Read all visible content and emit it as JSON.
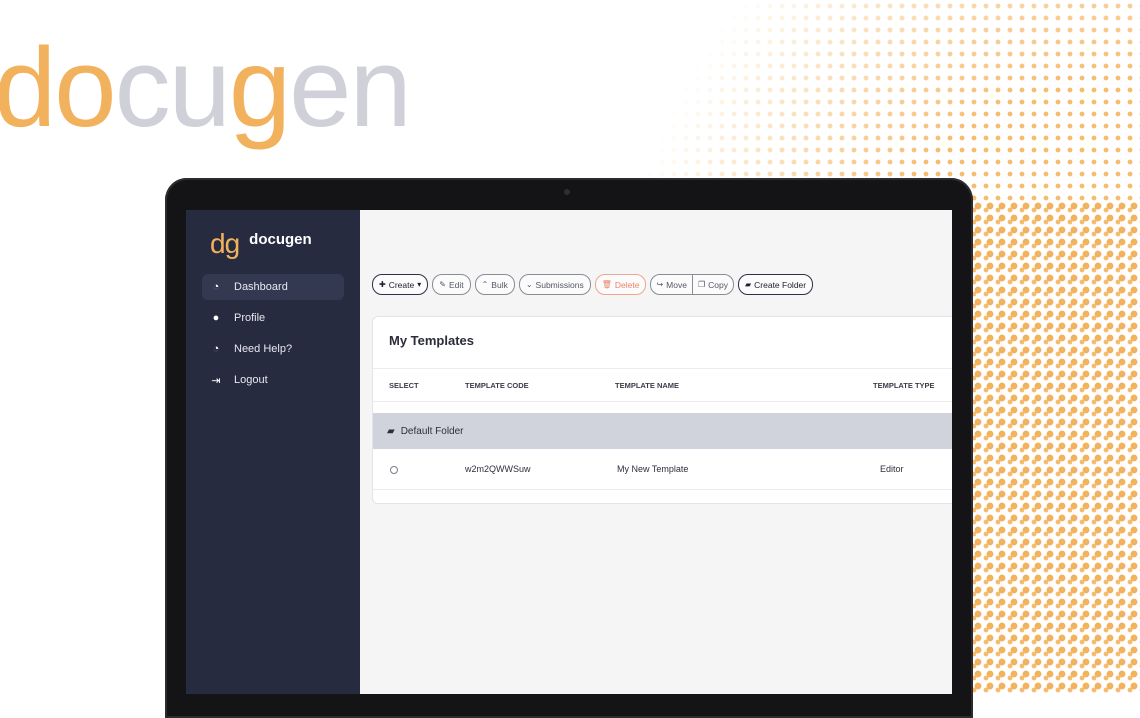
{
  "brand": {
    "part1": "do",
    "part2": "cu",
    "part3": "g",
    "part4": "en"
  },
  "sidebar": {
    "logo_mark": "dg",
    "logo_text": "docugen",
    "items": [
      {
        "label": "Dashboard",
        "icon": "pie-chart-icon",
        "glyph": "◔"
      },
      {
        "label": "Profile",
        "icon": "user-icon",
        "glyph": "👤"
      },
      {
        "label": "Need Help?",
        "icon": "headset-icon",
        "glyph": "🎧"
      },
      {
        "label": "Logout",
        "icon": "logout-icon",
        "glyph": "⇥"
      }
    ]
  },
  "toolbar": {
    "create": "Create",
    "edit": "Edit",
    "bulk": "Bulk",
    "submissions": "Submissions",
    "delete": "Delete",
    "move": "Move",
    "copy": "Copy",
    "create_folder": "Create Folder"
  },
  "card": {
    "title": "My Templates",
    "columns": [
      "SELECT",
      "TEMPLATE CODE",
      "TEMPLATE NAME",
      "TEMPLATE TYPE"
    ],
    "folder": "Default Folder",
    "rows": [
      {
        "code": "w2m2QWWSuw",
        "name": "My New Template",
        "type": "Editor"
      }
    ]
  },
  "colors": {
    "accent": "#f2b15d",
    "sidebar": "#272b3f",
    "danger": "#e98368"
  }
}
